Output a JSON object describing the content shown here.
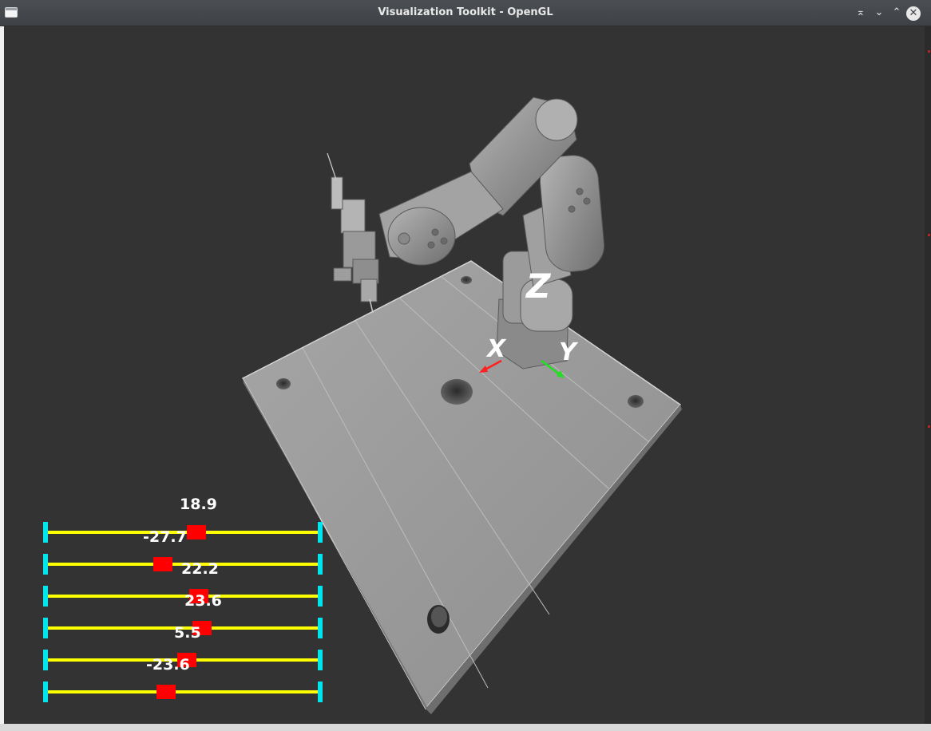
{
  "window": {
    "title": "Visualization Toolkit - OpenGL",
    "buttons": [
      "⌅",
      "⌄",
      "⌃",
      "✕"
    ]
  },
  "scene": {
    "description_free": true,
    "axes": {
      "x_label": "X",
      "y_label": "Y",
      "z_label": "Z"
    },
    "colors": {
      "background": "#333333",
      "model": "#9a9a9a",
      "slider_track": "#ffff00",
      "slider_cap": "#00e5ee",
      "slider_handle": "#ff0000",
      "axis_x": "#ff2020",
      "axis_y": "#20e020"
    }
  },
  "sliders": [
    {
      "label": "18.9",
      "fraction": 0.55
    },
    {
      "label": "-27.7",
      "fraction": 0.43
    },
    {
      "label": "22.2",
      "fraction": 0.56
    },
    {
      "label": "23.6",
      "fraction": 0.57
    },
    {
      "label": "5.5",
      "fraction": 0.51
    },
    {
      "label": "-23.6",
      "fraction": 0.44
    }
  ]
}
